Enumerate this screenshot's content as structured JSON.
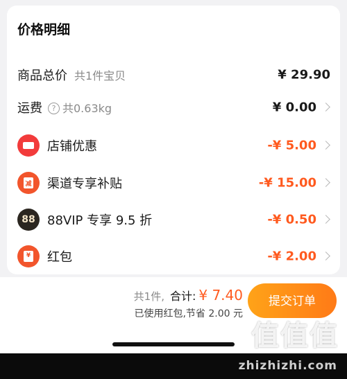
{
  "card": {
    "title": "价格明细",
    "rows": [
      {
        "label": "商品总价",
        "sub": "共1件宝贝",
        "value": "¥ 29.90"
      },
      {
        "label": "运费",
        "sub": "共0.63kg",
        "value": "¥ 0.00",
        "icon": "question-icon"
      },
      {
        "label": "店铺优惠",
        "value": "-¥ 5.00",
        "icon": "store-coupon-icon"
      },
      {
        "label": "渠道专享补贴",
        "value": "-¥ 15.00",
        "icon": "channel-subsidy-icon",
        "icon_text": "减"
      },
      {
        "label": "88VIP 专享 9.5 折",
        "value": "-¥ 0.50",
        "icon": "88vip-icon",
        "icon_text": "88"
      },
      {
        "label": "红包",
        "value": "-¥ 2.00",
        "icon": "red-packet-icon",
        "icon_text": "¥"
      }
    ]
  },
  "footer": {
    "count": "共1件,",
    "total_label": "合计:",
    "total_value": "¥ 7.40",
    "saving": "已使用红包,节省 2.00 元",
    "submit_label": "提交订单"
  },
  "watermark": {
    "text": "zhizhizhi.com",
    "logo": "值值值"
  },
  "colors": {
    "accent": "#ff5a1f",
    "button_start": "#ffa318",
    "button_end": "#ff7a17"
  }
}
